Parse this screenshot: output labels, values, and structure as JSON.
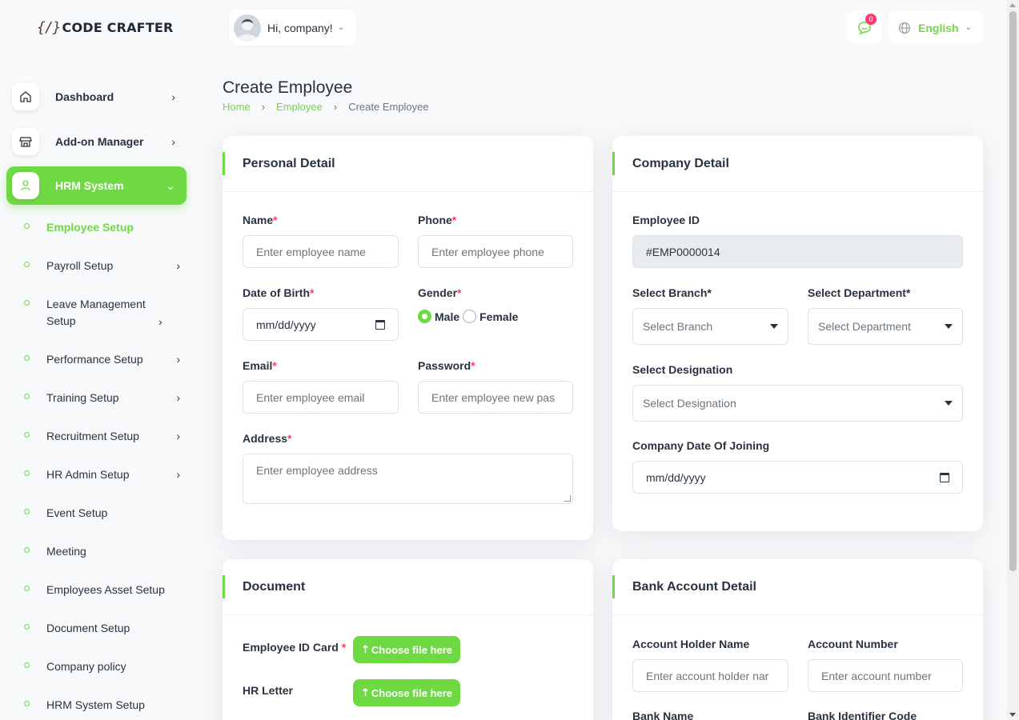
{
  "brand": {
    "mark": "{/}",
    "name": "CODE CRAFTER"
  },
  "header": {
    "greeting": "Hi, company!",
    "notification_count": "0",
    "language": "English"
  },
  "sidebar": {
    "items": [
      {
        "label": "Dashboard",
        "icon": "home-icon"
      },
      {
        "label": "Add-on Manager",
        "icon": "store-icon"
      },
      {
        "label": "HRM System",
        "icon": "user-icon",
        "active": true
      }
    ],
    "sub_items": [
      {
        "label": "Employee Setup",
        "active": true
      },
      {
        "label": "Payroll Setup"
      },
      {
        "label": "Leave Management Setup"
      },
      {
        "label": "Performance Setup"
      },
      {
        "label": "Training Setup"
      },
      {
        "label": "Recruitment Setup"
      },
      {
        "label": "HR Admin Setup"
      },
      {
        "label": "Event Setup"
      },
      {
        "label": "Meeting"
      },
      {
        "label": "Employees Asset Setup"
      },
      {
        "label": "Document Setup"
      },
      {
        "label": "Company policy"
      },
      {
        "label": "HRM System Setup"
      }
    ]
  },
  "page": {
    "title": "Create Employee",
    "breadcrumb": [
      "Home",
      "Employee",
      "Create Employee"
    ]
  },
  "personal": {
    "title": "Personal Detail",
    "name_label": "Name",
    "name_placeholder": "Enter employee name",
    "phone_label": "Phone",
    "phone_placeholder": "Enter employee phone",
    "dob_label": "Date of Birth",
    "dob_value": "mm/dd/yyyy",
    "gender_label": "Gender",
    "gender_options": [
      "Male",
      "Female"
    ],
    "gender_selected": "Male",
    "email_label": "Email",
    "email_placeholder": "Enter employee email",
    "password_label": "Password",
    "password_placeholder": "Enter employee new pas",
    "address_label": "Address",
    "address_placeholder": "Enter employee address",
    "required_mark": "*"
  },
  "company": {
    "title": "Company Detail",
    "employee_id_label": "Employee ID",
    "employee_id_value": "#EMP0000014",
    "branch_label": "Select Branch*",
    "branch_placeholder": "Select Branch",
    "department_label": "Select Department*",
    "department_placeholder": "Select Department",
    "designation_label": "Select Designation",
    "designation_placeholder": "Select Designation",
    "joining_label": "Company Date Of Joining",
    "joining_value": "mm/dd/yyyy"
  },
  "document": {
    "title": "Document",
    "id_card_label": "Employee ID Card",
    "hr_letter_label": "HR Letter",
    "upload_label": "Choose file here",
    "required_mark": "*"
  },
  "bank": {
    "title": "Bank Account Detail",
    "holder_label": "Account Holder Name",
    "holder_placeholder": "Enter account holder nar",
    "number_label": "Account Number",
    "number_placeholder": "Enter account number",
    "bank_name_label": "Bank Name",
    "identifier_label": "Bank Identifier Code"
  },
  "colors": {
    "accent": "#6fd943",
    "danger": "#ff3a6e",
    "text": "#293240"
  }
}
